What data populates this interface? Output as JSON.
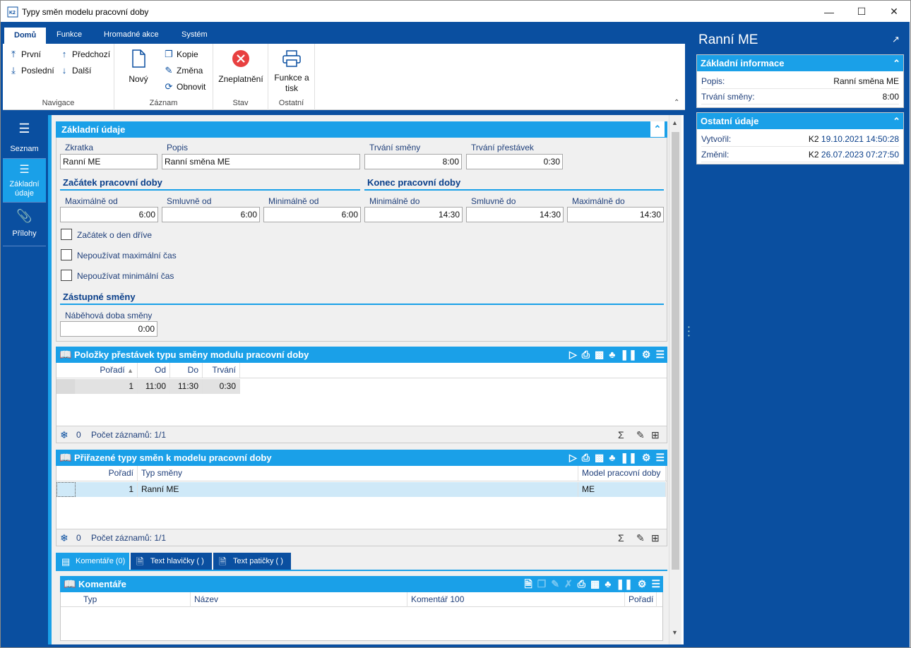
{
  "window": {
    "title": "Typy směn modelu pracovní doby",
    "app_icon": "K2",
    "min_icon": "minimize-icon",
    "max_icon": "maximize-icon",
    "close_icon": "close-icon"
  },
  "ribbon": {
    "tabs": [
      "Domů",
      "Funkce",
      "Hromadné akce",
      "Systém"
    ],
    "navigace": {
      "prvni": "První",
      "posledni": "Poslední",
      "predchozi": "Předchozí",
      "dalsi": "Další",
      "label": "Navigace"
    },
    "zaznam": {
      "novy": "Nový",
      "kopie": "Kopie",
      "zmena": "Změna",
      "obnovit": "Obnovit",
      "label": "Záznam"
    },
    "stav": {
      "zneplatneni": "Zneplatnění",
      "label": "Stav"
    },
    "ostatni": {
      "funkce_tisk_1": "Funkce a",
      "funkce_tisk_2": "tisk",
      "label": "Ostatní"
    }
  },
  "leftnav": {
    "seznam": "Seznam",
    "zakladni_1": "Základní",
    "zakladni_2": "údaje",
    "prilohy": "Přílohy"
  },
  "form": {
    "section_title": "Základní údaje",
    "zkratka_label": "Zkratka",
    "zkratka": "Ranní ME",
    "popis_label": "Popis",
    "popis": "Ranní směna ME",
    "trvani_smeny_label": "Trvání směny",
    "trvani_smeny": "8:00",
    "trvani_prestavek_label": "Trvání přestávek",
    "trvani_prestavek": "0:30",
    "zacatek_title": "Začátek pracovní doby",
    "konec_title": "Konec pracovní doby",
    "max_od_label": "Maximálně od",
    "max_od": "6:00",
    "smluvne_od_label": "Smluvně od",
    "smluvne_od": "6:00",
    "min_od_label": "Minimálně od",
    "min_od": "6:00",
    "min_do_label": "Minimálně do",
    "min_do": "14:30",
    "smluvne_do_label": "Smluvně do",
    "smluvne_do": "14:30",
    "max_do_label": "Maximálně do",
    "max_do": "14:30",
    "cb_den_drive": "Začátek o den dříve",
    "cb_nepouzivat_max": "Nepoužívat maximální čas",
    "cb_nepouzivat_min": "Nepoužívat minimální čas",
    "zastupne_title": "Zástupné směny",
    "nabehova_label": "Náběhová doba směny",
    "nabehova": "0:00"
  },
  "grid1": {
    "title": "Položky přestávek typu směny modulu pracovní doby",
    "headers": [
      "Pořadí",
      "Od",
      "Do",
      "Trvání"
    ],
    "rows": [
      [
        "1",
        "11:00",
        "11:30",
        "0:30"
      ]
    ],
    "footer_count": "0",
    "footer_text": "Počet záznamů: 1/1"
  },
  "grid2": {
    "title": "Přiřazené typy směn k modelu pracovní doby",
    "headers": [
      "Pořadí",
      "Typ směny",
      "Model pracovní doby"
    ],
    "rows": [
      [
        "1",
        "Ranní ME",
        "ME"
      ]
    ],
    "footer_count": "0",
    "footer_text": "Počet záznamů: 1/1"
  },
  "bottomtabs": [
    "Komentáře (0)",
    "Text hlavičky ( )",
    "Text patičky ( )"
  ],
  "grid3": {
    "title": "Komentáře",
    "headers": [
      "Typ",
      "Název",
      "Komentář 100",
      "Pořadí"
    ]
  },
  "right": {
    "title": "Ranní ME",
    "zakladni_title": "Základní informace",
    "popis_label": "Popis:",
    "popis": "Ranní směna ME",
    "trvani_label": "Trvání směny:",
    "trvani": "8:00",
    "ostatni_title": "Ostatní údaje",
    "vytvoril_label": "Vytvořil:",
    "vytvoril_user": "K2",
    "vytvoril_date": "19.10.2021 14:50:28",
    "zmenil_label": "Změnil:",
    "zmenil_user": "K2",
    "zmenil_date": "26.07.2023 07:27:50"
  }
}
